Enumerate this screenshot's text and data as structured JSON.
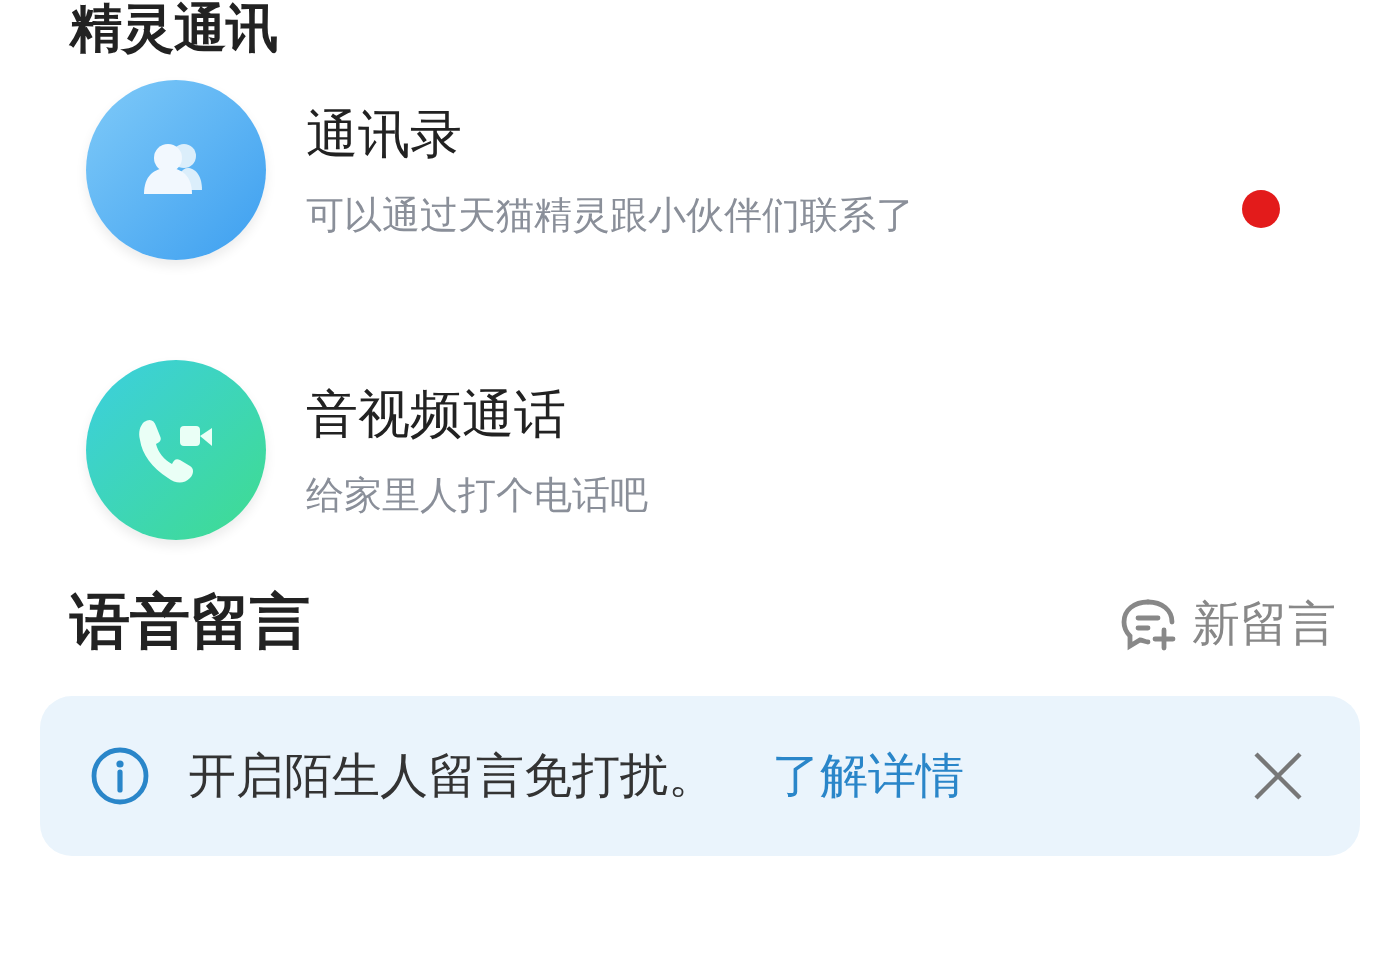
{
  "sections": [
    {
      "title": "精灵通讯",
      "items": [
        {
          "kind": "contacts",
          "title": "通讯录",
          "subtitle": "可以通过天猫精灵跟小伙伴们联系了",
          "unread": true
        },
        {
          "kind": "call",
          "title": "音视频通话",
          "subtitle": "给家里人打个电话吧",
          "unread": false
        }
      ]
    },
    {
      "title": "语音留言",
      "action": "新留言",
      "banner": {
        "text": "开启陌生人留言免打扰。",
        "link": "了解详情"
      }
    }
  ]
}
